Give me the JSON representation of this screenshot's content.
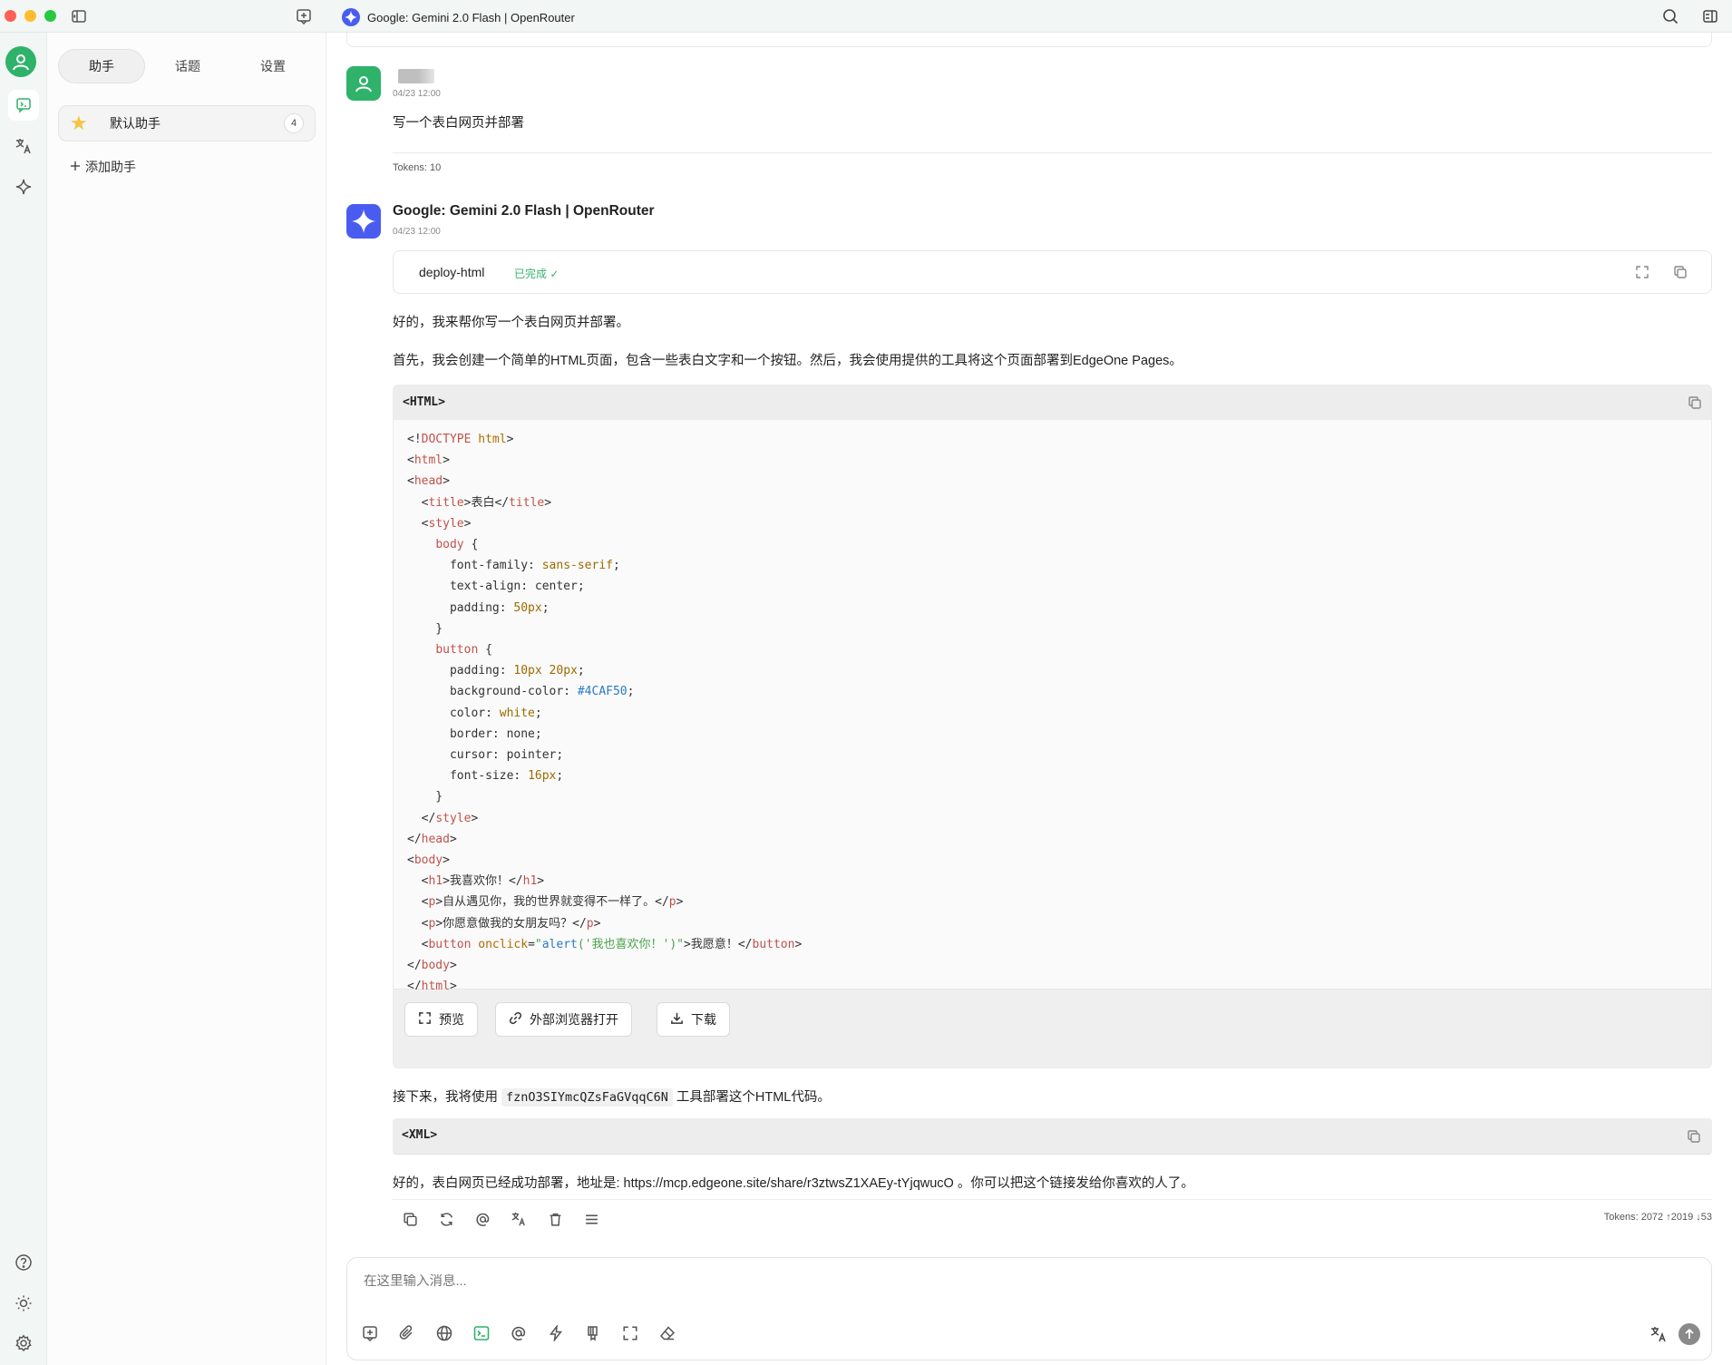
{
  "window": {
    "title": "Google: Gemini 2.0 Flash | OpenRouter"
  },
  "sidebar": {
    "tabs": [
      {
        "label": "助手"
      },
      {
        "label": "话题"
      },
      {
        "label": "设置"
      }
    ],
    "assistant": {
      "name": "默认助手",
      "count": "4"
    },
    "add_label": "添加助手"
  },
  "chat": {
    "user_message": {
      "time": "04/23 12:00",
      "text": "写一个表白网页并部署",
      "tokens": "Tokens: 10"
    },
    "ai_message": {
      "name": "Google: Gemini 2.0 Flash | OpenRouter",
      "time": "04/23 12:00",
      "tool": {
        "name": "deploy-html",
        "status": "已完成 ✓"
      },
      "para1": "好的，我来帮你写一个表白网页并部署。",
      "para2": "首先，我会创建一个简单的HTML页面，包含一些表白文字和一个按钮。然后，我会使用提供的工具将这个页面部署到EdgeOne Pages。",
      "code_lang": "<HTML>",
      "code_buttons": [
        "预览",
        "外部浏览器打开",
        "下载"
      ],
      "para3_before": "接下来，我将使用",
      "para3_code": "fznO3SIYmcQZsFaGVqqC6N",
      "para3_after": "工具部署这个HTML代码。",
      "xml_lang": "<XML>",
      "para4": "好的，表白网页已经成功部署，地址是: https://mcp.edgeone.site/share/r3ztwsZ1XAEy-tYjqwucO 。你可以把这个链接发给你喜欢的人了。",
      "tokens": "Tokens: 2072 ↑2019 ↓53"
    }
  },
  "code_lines": [
    {
      "h": "&lt;!<span class='c-tag'>DOCTYPE</span> <span class='c-attr'>html</span>&gt;"
    },
    {
      "h": "&lt;<span class='c-tag'>html</span>&gt;"
    },
    {
      "h": "&lt;<span class='c-tag'>head</span>&gt;"
    },
    {
      "h": "  &lt;<span class='c-tag'>title</span>&gt;表白&lt;/<span class='c-tag'>title</span>&gt;"
    },
    {
      "h": "  &lt;<span class='c-tag'>style</span>&gt;"
    },
    {
      "h": "    <span class='c-tag'>body</span> {"
    },
    {
      "h": "      font-family: <span class='c-num'>sans-serif</span>;"
    },
    {
      "h": "      text-align: center;"
    },
    {
      "h": "      padding: <span class='c-num'>50px</span>;"
    },
    {
      "h": "    }"
    },
    {
      "h": "    <span class='c-tag'>button</span> {"
    },
    {
      "h": "      padding: <span class='c-num'>10px 20px</span>;"
    },
    {
      "h": "      background-color: <span class='c-hex'>#4CAF50</span>;"
    },
    {
      "h": "      color: <span class='c-num'>white</span>;"
    },
    {
      "h": "      border: none;"
    },
    {
      "h": "      cursor: pointer;"
    },
    {
      "h": "      font-size: <span class='c-num'>16px</span>;"
    },
    {
      "h": "    }"
    },
    {
      "h": "  &lt;/<span class='c-tag'>style</span>&gt;"
    },
    {
      "h": "&lt;/<span class='c-tag'>head</span>&gt;"
    },
    {
      "h": "&lt;<span class='c-tag'>body</span>&gt;"
    },
    {
      "h": "  &lt;<span class='c-tag'>h1</span>&gt;我喜欢你！&lt;/<span class='c-tag'>h1</span>&gt;"
    },
    {
      "h": "  &lt;<span class='c-tag'>p</span>&gt;自从遇见你，我的世界就变得不一样了。&lt;/<span class='c-tag'>p</span>&gt;"
    },
    {
      "h": "  &lt;<span class='c-tag'>p</span>&gt;你愿意做我的女朋友吗？&lt;/<span class='c-tag'>p</span>&gt;"
    },
    {
      "h": "  &lt;<span class='c-tag'>button</span> <span class='c-attr'>onclick</span>=<span class='c-str'>\"<span class='c-fn'>alert</span>('我也喜欢你！')\"</span>&gt;我愿意！&lt;/<span class='c-tag'>button</span>&gt;"
    },
    {
      "h": "&lt;/<span class='c-tag'>body</span>&gt;"
    },
    {
      "h": "&lt;/<span class='c-tag'>html</span>&gt;"
    }
  ],
  "input": {
    "placeholder": "在这里输入消息..."
  }
}
